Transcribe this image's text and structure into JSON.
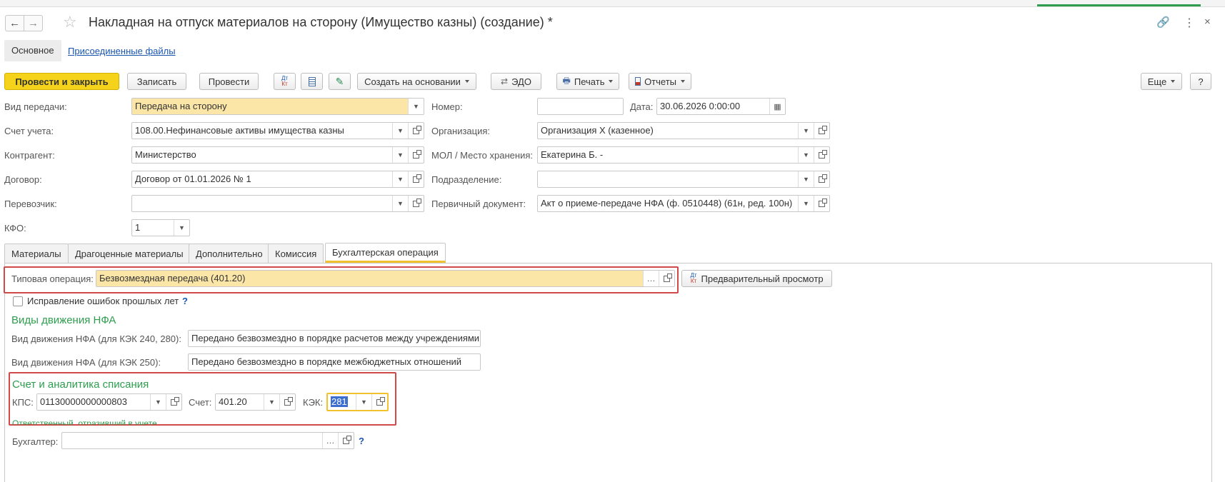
{
  "window": {
    "title": "Накладная на отпуск материалов на сторону (Имущество казны) (создание) *",
    "nav_back": "←",
    "nav_forward": "→"
  },
  "subnav": {
    "main": "Основное",
    "attached": "Присоединенные файлы"
  },
  "toolbar": {
    "post_close": "Провести и закрыть",
    "save": "Записать",
    "post": "Провести",
    "dtkt": "Дт Кт",
    "create_based": "Создать на основании",
    "edo": "ЭДО",
    "print": "Печать",
    "reports": "Отчеты",
    "more": "Еще",
    "help": "?"
  },
  "form": {
    "transfer_type_label": "Вид передачи:",
    "transfer_type_value": "Передача на сторону",
    "number_label": "Номер:",
    "number_value": "",
    "date_label": "Дата:",
    "date_value": "30.06.2026  0:00:00",
    "account_label": "Счет учета:",
    "account_value": "108.00.Нефинансовые активы имущества казны",
    "org_label": "Организация:",
    "org_value": "Организация Х (казенное)",
    "counterparty_label": "Контрагент:",
    "counterparty_value": "Министерство",
    "mol_label": "МОЛ / Место хранения:",
    "mol_value": "Екатерина Б. -",
    "contract_label": "Договор:",
    "contract_value": "Договор от 01.01.2026 № 1",
    "division_label": "Подразделение:",
    "division_value": "",
    "carrier_label": "Перевозчик:",
    "carrier_value": "",
    "primary_doc_label": "Первичный документ:",
    "primary_doc_value": "Акт о приеме-передаче НФА (ф. 0510448) (61н, ред. 100н)",
    "kfo_label": "КФО:",
    "kfo_value": "1"
  },
  "tabs": [
    "Материалы",
    "Драгоценные материалы",
    "Дополнительно",
    "Комиссия",
    "Бухгалтерская операция"
  ],
  "operation": {
    "typical_label": "Типовая операция:",
    "typical_value": "Безвозмездная передача (401.20)",
    "preview": "Предварительный просмотр",
    "fix_errors": "Исправление ошибок прошлых лет",
    "fix_help": "?",
    "nfa_section": "Виды движения НФА",
    "nfa_240_label": "Вид движения НФА (для КЭК 240, 280):",
    "nfa_240_value": "Передано безвозмездно в порядке расчетов между учреждениями",
    "nfa_250_label": "Вид движения НФА (для КЭК 250):",
    "nfa_250_value": "Передано безвозмездно в порядке межбюджетных отношений",
    "writeoff_section": "Счет и аналитика списания",
    "kps_label": "КПС:",
    "kps_value": "01130000000000803",
    "acc_label": "Счет:",
    "acc_value": "401.20",
    "kek_label": "КЭК:",
    "kek_value": "281",
    "responsible_section": "Ответственный, отразивший в учете",
    "accountant_label": "Бухгалтер:",
    "accountant_value": "",
    "acc_help": "?"
  },
  "colors": {
    "primary_button": "#f5d31a",
    "highlight_field": "#fbe6a8",
    "section_green": "#2e9e4e",
    "annotation_red": "#d04a4a",
    "link_blue": "#1a56b0"
  }
}
